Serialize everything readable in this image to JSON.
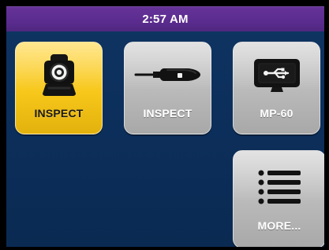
{
  "status_bar": {
    "time": "2:57 AM"
  },
  "tiles": [
    {
      "label": "INSPECT",
      "icon": "inspection-probe-icon",
      "selected": true
    },
    {
      "label": "INSPECT",
      "icon": "fiber-scope-icon",
      "selected": false
    },
    {
      "label": "MP-60",
      "icon": "usb-power-meter-icon",
      "selected": false
    },
    {
      "label": "MORE...",
      "icon": "list-icon",
      "selected": false
    }
  ],
  "colors": {
    "selected_tile": "#f7c71b",
    "tile": "#b9b9b9",
    "background": "#0c2f5b",
    "status_bar": "#5b2c8f"
  }
}
